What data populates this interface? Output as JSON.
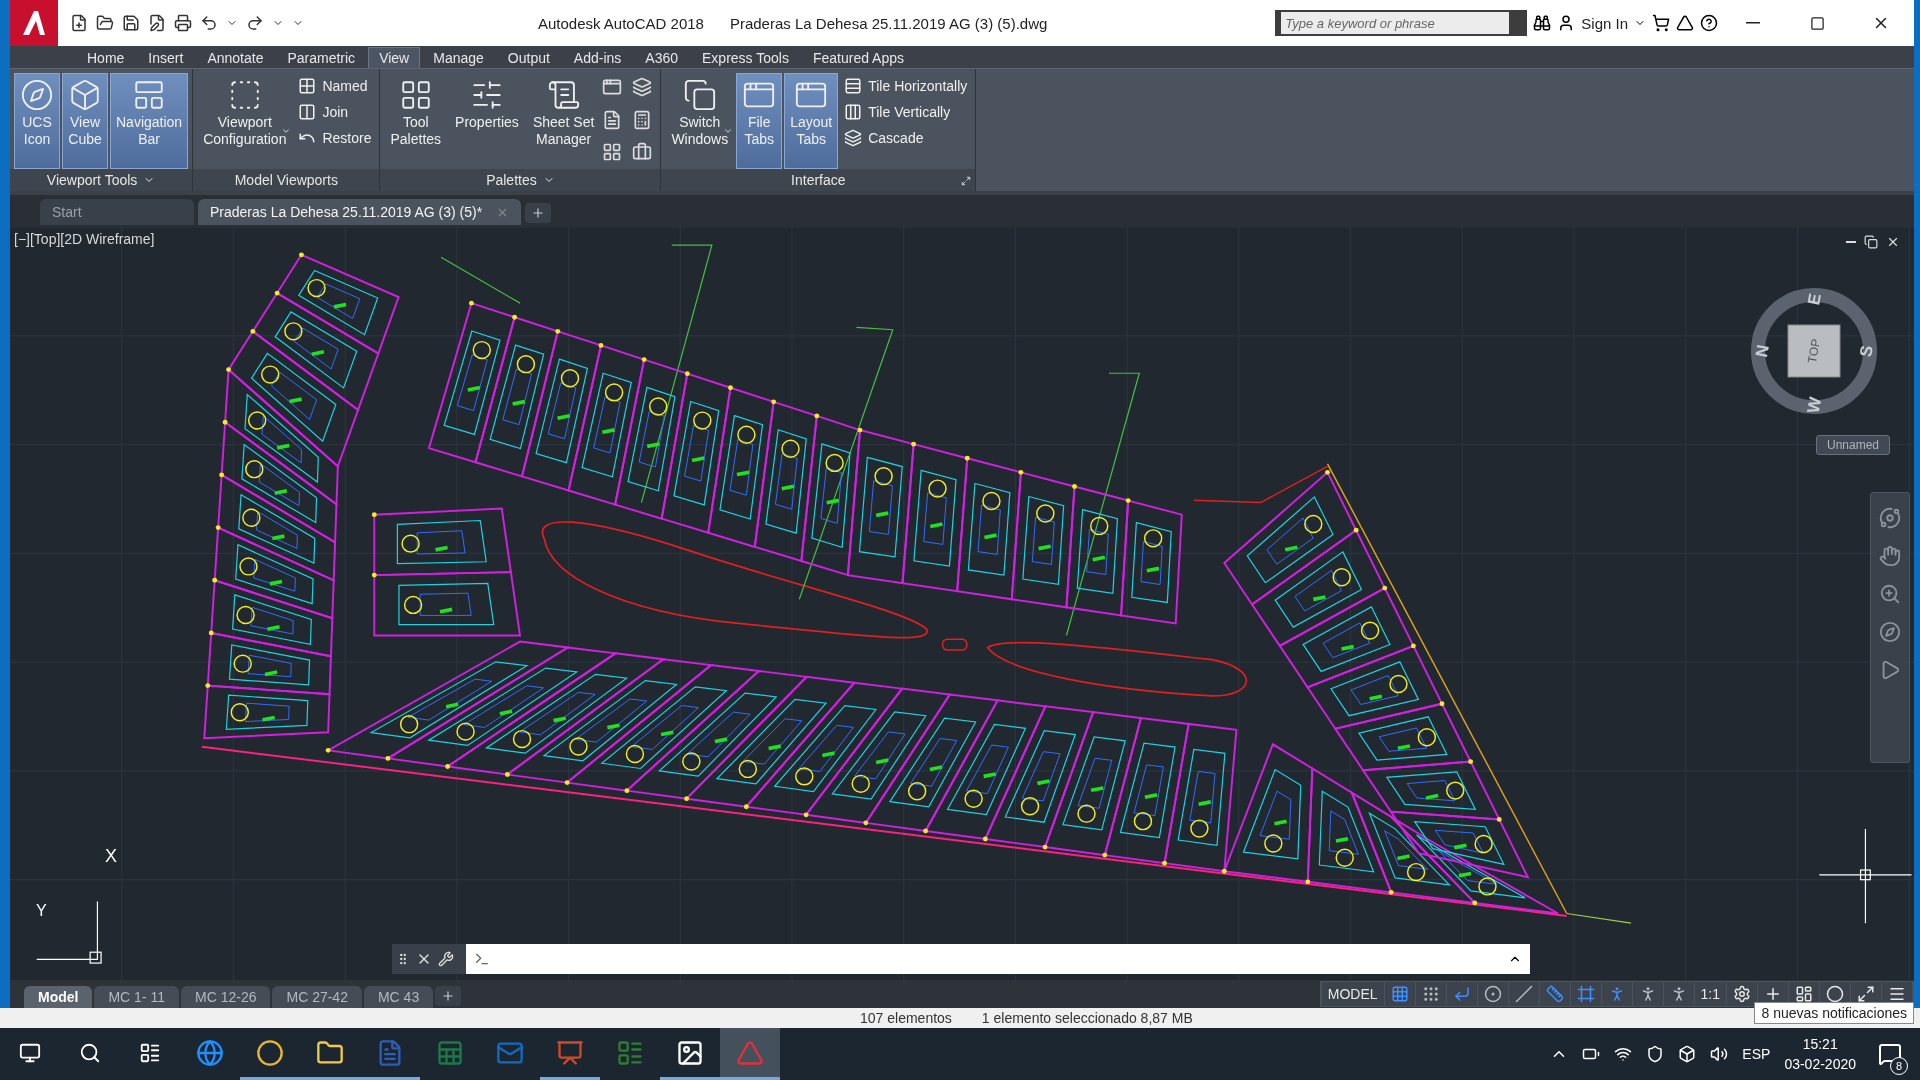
{
  "title_bar": {
    "app": "Autodesk AutoCAD 2018",
    "document": "Praderas La Dehesa 25.11.2019 AG (3) (5).dwg",
    "search": {
      "placeholder": "Type a keyword or phrase"
    },
    "sign_in": "Sign In"
  },
  "ribbon_tabs": [
    {
      "label": "Home",
      "selected": false
    },
    {
      "label": "Insert",
      "selected": false
    },
    {
      "label": "Annotate",
      "selected": false
    },
    {
      "label": "Parametric",
      "selected": false
    },
    {
      "label": "View",
      "selected": true
    },
    {
      "label": "Manage",
      "selected": false
    },
    {
      "label": "Output",
      "selected": false
    },
    {
      "label": "Add-ins",
      "selected": false
    },
    {
      "label": "A360",
      "selected": false
    },
    {
      "label": "Express Tools",
      "selected": false
    },
    {
      "label": "Featured Apps",
      "selected": false
    }
  ],
  "ribbon_panels": [
    {
      "title": "Viewport Tools",
      "menu": true,
      "launcher": false,
      "icon_grid": false,
      "large": [
        {
          "lines": [
            "UCS",
            "Icon"
          ],
          "active": true,
          "dropdown": false
        },
        {
          "lines": [
            "View",
            "Cube"
          ],
          "active": true,
          "dropdown": false
        },
        {
          "lines": [
            "Navigation",
            "Bar"
          ],
          "active": true,
          "dropdown": false
        }
      ]
    },
    {
      "title": "Model Viewports",
      "menu": false,
      "launcher": false,
      "icon_grid": false,
      "large": [
        {
          "lines": [
            "Viewport",
            "Configuration"
          ],
          "active": false,
          "dropdown": true
        }
      ],
      "small": [
        "Named",
        "Join",
        "Restore"
      ]
    },
    {
      "title": "Palettes",
      "menu": true,
      "launcher": false,
      "icon_grid": true,
      "large": [
        {
          "lines": [
            "Tool",
            "Palettes"
          ],
          "active": false,
          "dropdown": false
        },
        {
          "lines": [
            "Properties"
          ],
          "active": false,
          "dropdown": false
        },
        {
          "lines": [
            "Sheet Set",
            "Manager"
          ],
          "active": false,
          "dropdown": false
        }
      ]
    },
    {
      "title": "Interface",
      "menu": false,
      "launcher": true,
      "icon_grid": false,
      "large": [
        {
          "lines": [
            "Switch",
            "Windows"
          ],
          "active": false,
          "dropdown": true
        },
        {
          "lines": [
            "File",
            "Tabs"
          ],
          "active": true,
          "dropdown": false
        },
        {
          "lines": [
            "Layout",
            "Tabs"
          ],
          "active": true,
          "dropdown": false
        }
      ],
      "small": [
        "Tile Horizontally",
        "Tile Vertically",
        "Cascade"
      ]
    }
  ],
  "document_tabs": [
    {
      "label": "Start",
      "selected": false,
      "closable": false
    },
    {
      "label": "Praderas La Dehesa 25.11.2019 AG (3) (5)*",
      "selected": true,
      "closable": true
    }
  ],
  "viewport": {
    "label": "[−][Top][2D Wireframe]",
    "viewcube": {
      "face": "TOP",
      "north": "N",
      "south": "S",
      "east": "E",
      "west": "W",
      "coordinate_system": "Unnamed"
    },
    "ucs": {
      "x": "X",
      "y": "Y"
    }
  },
  "layout_tabs": [
    {
      "label": "Model",
      "selected": true
    },
    {
      "label": "MC 1- 11",
      "selected": false
    },
    {
      "label": "MC 12-26",
      "selected": false
    },
    {
      "label": "MC 27-42",
      "selected": false
    },
    {
      "label": "MC 43",
      "selected": false
    }
  ],
  "status_bar": {
    "space": "MODEL",
    "scale": "1:1",
    "toggles": [
      {
        "on": true
      },
      {
        "on": false
      },
      {
        "on": true
      },
      {
        "on": false
      },
      {
        "on": false
      },
      {
        "on": true
      },
      {
        "on": true
      },
      {
        "on": true
      },
      {
        "on": false
      },
      {
        "on": false
      }
    ],
    "notification": "8 nuevas notificaciones"
  },
  "background_window": {
    "item_count": "107 elementos",
    "selection": "1 elemento seleccionado  8,87 MB"
  },
  "taskbar": {
    "apps": [
      {
        "running": false,
        "selected": false
      },
      {
        "running": true,
        "selected": false
      },
      {
        "running": true,
        "selected": false
      },
      {
        "running": true,
        "selected": false
      },
      {
        "running": false,
        "selected": false
      },
      {
        "running": false,
        "selected": false
      },
      {
        "running": true,
        "selected": false
      },
      {
        "running": false,
        "selected": false
      },
      {
        "running": true,
        "selected": false
      },
      {
        "running": true,
        "selected": true
      }
    ],
    "language": "ESP",
    "time": "15:21",
    "date": "03-02-2020",
    "notification_count": "8"
  }
}
